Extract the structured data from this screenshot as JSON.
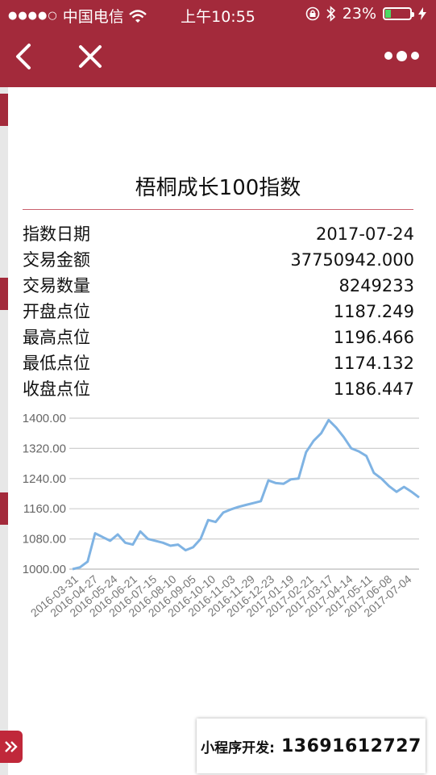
{
  "status_bar": {
    "carrier": "中国电信",
    "time": "上午10:55",
    "battery_percent": "23%",
    "battery_level": 0.23,
    "icons": [
      "signal-dots-icon",
      "wifi-icon",
      "rotation-lock-icon",
      "bluetooth-icon",
      "battery-icon",
      "charging-icon"
    ]
  },
  "nav": {
    "icons": [
      "back-icon",
      "close-icon",
      "more-icon"
    ]
  },
  "index": {
    "title": "梧桐成长100指数",
    "rows": [
      {
        "label": "指数日期",
        "value": "2017-07-24"
      },
      {
        "label": "交易金额",
        "value": "37750942.000"
      },
      {
        "label": "交易数量",
        "value": "8249233"
      },
      {
        "label": "开盘点位",
        "value": "1187.249"
      },
      {
        "label": "最高点位",
        "value": "1196.466"
      },
      {
        "label": "最低点位",
        "value": "1174.132"
      },
      {
        "label": "收盘点位",
        "value": "1186.447"
      }
    ]
  },
  "chart_data": {
    "type": "line",
    "title": "",
    "xlabel": "",
    "ylabel": "",
    "ylim": [
      1000,
      1400
    ],
    "yticks": [
      "1000.00",
      "1080.00",
      "1160.00",
      "1240.00",
      "1320.00",
      "1400.00"
    ],
    "grid": true,
    "line_color": "#7fb3e3",
    "categories": [
      "2016-03-31",
      "2016-04-27",
      "2016-05-24",
      "2016-06-21",
      "2016-07-15",
      "2016-08-10",
      "2016-09-05",
      "2016-10-10",
      "2016-11-03",
      "2016-11-29",
      "2016-12-23",
      "2017-01-19",
      "2017-02-21",
      "2017-03-17",
      "2017-04-14",
      "2017-05-11",
      "2017-06-08",
      "2017-07-04"
    ],
    "series": [
      {
        "values": [
          1000,
          1005,
          1020,
          1095,
          1085,
          1075,
          1092,
          1070,
          1065,
          1100,
          1080,
          1075,
          1070,
          1062,
          1065,
          1050,
          1058,
          1080,
          1130,
          1125,
          1150,
          1158,
          1165,
          1170,
          1175,
          1180,
          1235,
          1228,
          1226,
          1238,
          1240,
          1310,
          1340,
          1360,
          1395,
          1375,
          1350,
          1320,
          1312,
          1300,
          1255,
          1240,
          1220,
          1205,
          1218,
          1205,
          1190
        ]
      }
    ]
  },
  "promo": {
    "label": "小程序开发:",
    "phone": "13691612727"
  }
}
